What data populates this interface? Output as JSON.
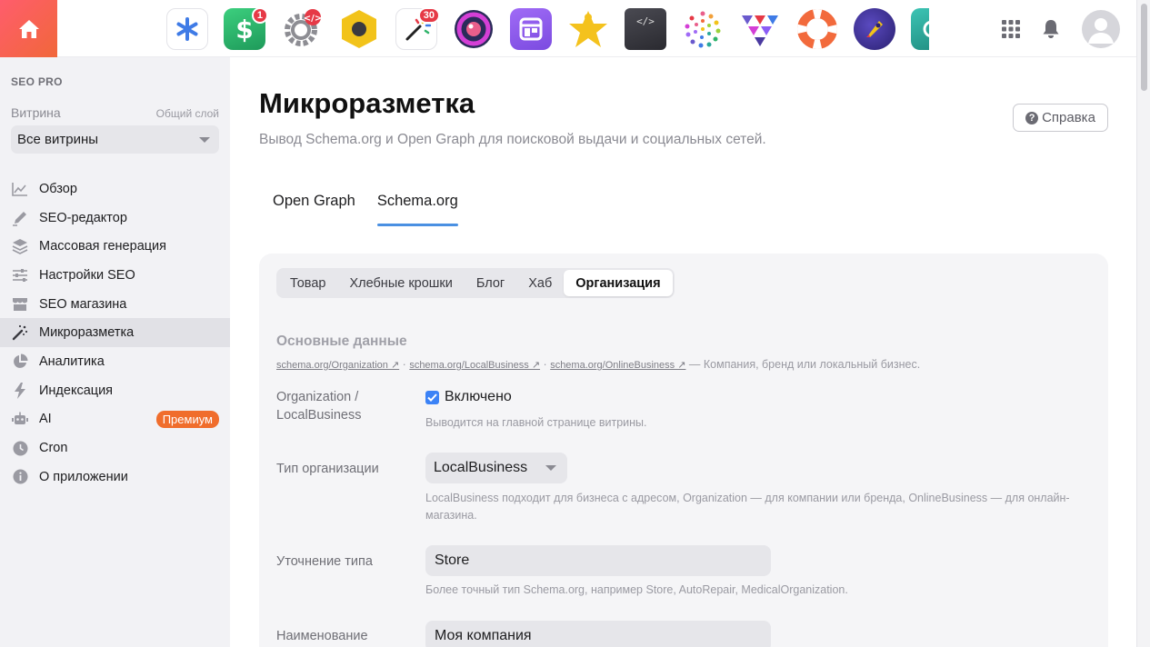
{
  "topbar": {
    "apps": [
      {
        "icon": "asterisk-app-icon",
        "color": "#3f7be6",
        "badge": ""
      },
      {
        "icon": "dollar-app-icon",
        "color": "#2fb36a",
        "badge": "1"
      },
      {
        "icon": "gear-code-app-icon",
        "color": "#8d8d93",
        "badge": ""
      },
      {
        "icon": "hexagon-app-icon",
        "color": "#f2c31a",
        "badge": ""
      },
      {
        "icon": "magic-wand-app-icon",
        "color": "#ffffff",
        "badge": "30"
      },
      {
        "icon": "camera-ring-app-icon",
        "color": "#c43ad1",
        "badge": ""
      },
      {
        "icon": "window-app-icon",
        "color": "#8b5cf6",
        "badge": ""
      },
      {
        "icon": "star-person-app-icon",
        "color": "#f4c21d",
        "badge": ""
      },
      {
        "icon": "code-book-app-icon",
        "color": "#3a3a40",
        "badge": ""
      },
      {
        "icon": "dots-circle-app-icon",
        "color": "#e95f8b",
        "badge": ""
      },
      {
        "icon": "triangles-app-icon",
        "color": "#6a5acd",
        "badge": ""
      },
      {
        "icon": "lifebuoy-app-icon",
        "color": "#f26a3c",
        "badge": ""
      },
      {
        "icon": "rocket-app-icon",
        "color": "#4a3aa0",
        "badge": ""
      },
      {
        "icon": "teal-app-icon",
        "color": "#2aa89a",
        "badge": ""
      }
    ]
  },
  "sidebar": {
    "brand": "SEO PRO",
    "storefront_label": "Витрина",
    "layer_label": "Общий слой",
    "storefront_value": "Все витрины",
    "items": [
      {
        "label": "Обзор",
        "icon": "chart-line-icon"
      },
      {
        "label": "SEO-редактор",
        "icon": "pen-icon"
      },
      {
        "label": "Массовая генерация",
        "icon": "layers-icon"
      },
      {
        "label": "Настройки SEO",
        "icon": "sliders-icon"
      },
      {
        "label": "SEO магазина",
        "icon": "store-icon"
      },
      {
        "label": "Микроразметка",
        "icon": "magic-wand-icon"
      },
      {
        "label": "Аналитика",
        "icon": "pie-chart-icon"
      },
      {
        "label": "Индексация",
        "icon": "lightning-icon"
      },
      {
        "label": "AI",
        "icon": "robot-icon",
        "premium": "Премиум"
      },
      {
        "label": "Cron",
        "icon": "clock-icon"
      },
      {
        "label": "О приложении",
        "icon": "info-icon"
      }
    ]
  },
  "main": {
    "title": "Микроразметка",
    "subtitle": "Вывод Schema.org и Open Graph для поисковой выдачи и социальных сетей.",
    "help_label": "Справка",
    "tabs": [
      "Open Graph",
      "Schema.org"
    ],
    "segments": [
      "Товар",
      "Хлебные крошки",
      "Блог",
      "Хаб",
      "Организация"
    ],
    "section_title": "Основные данные",
    "refs": {
      "link1": "schema.org/Organization ↗",
      "link2": "schema.org/LocalBusiness ↗",
      "link3": "schema.org/OnlineBusiness ↗",
      "sep": "·",
      "tail": "— Компания, бренд или локальный бизнес."
    },
    "form": {
      "org_label_1": "Organization /",
      "org_label_2": "LocalBusiness",
      "enabled_label": "Включено",
      "enabled_hint": "Выводится на главной странице витрины.",
      "type_label": "Тип организации",
      "type_value": "LocalBusiness",
      "type_hint": "LocalBusiness подходит для бизнеса с адресом, Organization — для компании или бренда, OnlineBusiness — для онлайн-магазина.",
      "subtype_label": "Уточнение типа",
      "subtype_value": "Store",
      "subtype_hint": "Более точный тип Schema.org, например Store, AutoRepair, MedicalOrganization.",
      "name_label": "Наименование",
      "name_value": "Моя компания"
    }
  }
}
